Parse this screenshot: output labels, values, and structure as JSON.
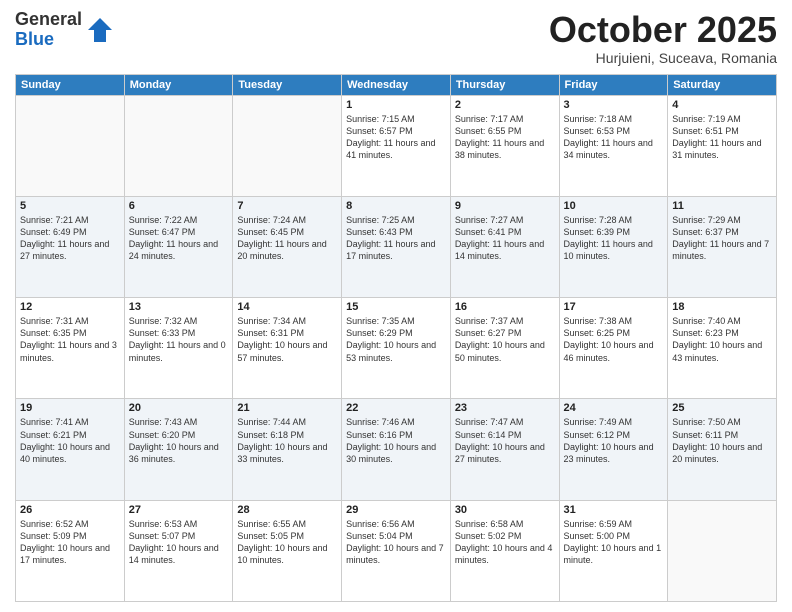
{
  "header": {
    "logo_general": "General",
    "logo_blue": "Blue",
    "month_title": "October 2025",
    "subtitle": "Hurjuieni, Suceava, Romania"
  },
  "days_of_week": [
    "Sunday",
    "Monday",
    "Tuesday",
    "Wednesday",
    "Thursday",
    "Friday",
    "Saturday"
  ],
  "weeks": [
    [
      {
        "day": "",
        "info": ""
      },
      {
        "day": "",
        "info": ""
      },
      {
        "day": "",
        "info": ""
      },
      {
        "day": "1",
        "info": "Sunrise: 7:15 AM\nSunset: 6:57 PM\nDaylight: 11 hours and 41 minutes."
      },
      {
        "day": "2",
        "info": "Sunrise: 7:17 AM\nSunset: 6:55 PM\nDaylight: 11 hours and 38 minutes."
      },
      {
        "day": "3",
        "info": "Sunrise: 7:18 AM\nSunset: 6:53 PM\nDaylight: 11 hours and 34 minutes."
      },
      {
        "day": "4",
        "info": "Sunrise: 7:19 AM\nSunset: 6:51 PM\nDaylight: 11 hours and 31 minutes."
      }
    ],
    [
      {
        "day": "5",
        "info": "Sunrise: 7:21 AM\nSunset: 6:49 PM\nDaylight: 11 hours and 27 minutes."
      },
      {
        "day": "6",
        "info": "Sunrise: 7:22 AM\nSunset: 6:47 PM\nDaylight: 11 hours and 24 minutes."
      },
      {
        "day": "7",
        "info": "Sunrise: 7:24 AM\nSunset: 6:45 PM\nDaylight: 11 hours and 20 minutes."
      },
      {
        "day": "8",
        "info": "Sunrise: 7:25 AM\nSunset: 6:43 PM\nDaylight: 11 hours and 17 minutes."
      },
      {
        "day": "9",
        "info": "Sunrise: 7:27 AM\nSunset: 6:41 PM\nDaylight: 11 hours and 14 minutes."
      },
      {
        "day": "10",
        "info": "Sunrise: 7:28 AM\nSunset: 6:39 PM\nDaylight: 11 hours and 10 minutes."
      },
      {
        "day": "11",
        "info": "Sunrise: 7:29 AM\nSunset: 6:37 PM\nDaylight: 11 hours and 7 minutes."
      }
    ],
    [
      {
        "day": "12",
        "info": "Sunrise: 7:31 AM\nSunset: 6:35 PM\nDaylight: 11 hours and 3 minutes."
      },
      {
        "day": "13",
        "info": "Sunrise: 7:32 AM\nSunset: 6:33 PM\nDaylight: 11 hours and 0 minutes."
      },
      {
        "day": "14",
        "info": "Sunrise: 7:34 AM\nSunset: 6:31 PM\nDaylight: 10 hours and 57 minutes."
      },
      {
        "day": "15",
        "info": "Sunrise: 7:35 AM\nSunset: 6:29 PM\nDaylight: 10 hours and 53 minutes."
      },
      {
        "day": "16",
        "info": "Sunrise: 7:37 AM\nSunset: 6:27 PM\nDaylight: 10 hours and 50 minutes."
      },
      {
        "day": "17",
        "info": "Sunrise: 7:38 AM\nSunset: 6:25 PM\nDaylight: 10 hours and 46 minutes."
      },
      {
        "day": "18",
        "info": "Sunrise: 7:40 AM\nSunset: 6:23 PM\nDaylight: 10 hours and 43 minutes."
      }
    ],
    [
      {
        "day": "19",
        "info": "Sunrise: 7:41 AM\nSunset: 6:21 PM\nDaylight: 10 hours and 40 minutes."
      },
      {
        "day": "20",
        "info": "Sunrise: 7:43 AM\nSunset: 6:20 PM\nDaylight: 10 hours and 36 minutes."
      },
      {
        "day": "21",
        "info": "Sunrise: 7:44 AM\nSunset: 6:18 PM\nDaylight: 10 hours and 33 minutes."
      },
      {
        "day": "22",
        "info": "Sunrise: 7:46 AM\nSunset: 6:16 PM\nDaylight: 10 hours and 30 minutes."
      },
      {
        "day": "23",
        "info": "Sunrise: 7:47 AM\nSunset: 6:14 PM\nDaylight: 10 hours and 27 minutes."
      },
      {
        "day": "24",
        "info": "Sunrise: 7:49 AM\nSunset: 6:12 PM\nDaylight: 10 hours and 23 minutes."
      },
      {
        "day": "25",
        "info": "Sunrise: 7:50 AM\nSunset: 6:11 PM\nDaylight: 10 hours and 20 minutes."
      }
    ],
    [
      {
        "day": "26",
        "info": "Sunrise: 6:52 AM\nSunset: 5:09 PM\nDaylight: 10 hours and 17 minutes."
      },
      {
        "day": "27",
        "info": "Sunrise: 6:53 AM\nSunset: 5:07 PM\nDaylight: 10 hours and 14 minutes."
      },
      {
        "day": "28",
        "info": "Sunrise: 6:55 AM\nSunset: 5:05 PM\nDaylight: 10 hours and 10 minutes."
      },
      {
        "day": "29",
        "info": "Sunrise: 6:56 AM\nSunset: 5:04 PM\nDaylight: 10 hours and 7 minutes."
      },
      {
        "day": "30",
        "info": "Sunrise: 6:58 AM\nSunset: 5:02 PM\nDaylight: 10 hours and 4 minutes."
      },
      {
        "day": "31",
        "info": "Sunrise: 6:59 AM\nSunset: 5:00 PM\nDaylight: 10 hours and 1 minute."
      },
      {
        "day": "",
        "info": ""
      }
    ]
  ]
}
